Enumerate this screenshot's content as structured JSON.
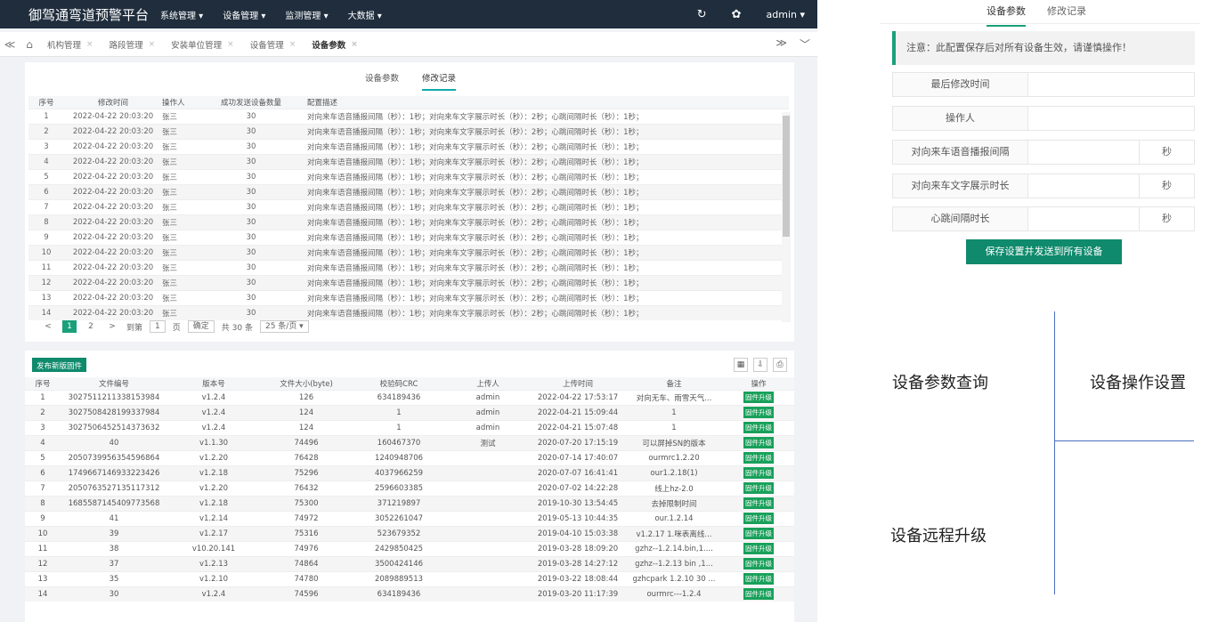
{
  "app": {
    "brand": "御驾通弯道预警平台",
    "menus": [
      "系统管理",
      "设备管理",
      "监测管理",
      "大数据"
    ],
    "user": "admin",
    "icons": {
      "refresh": "refresh-icon",
      "skin": "palette-icon",
      "home": "home-icon"
    }
  },
  "tabs": {
    "prev": "≪",
    "next": "≫",
    "down": "﹀",
    "items": [
      {
        "label": "机构管理",
        "close": "×"
      },
      {
        "label": "路段管理",
        "close": "×"
      },
      {
        "label": "安装单位管理",
        "close": "×"
      },
      {
        "label": "设备管理",
        "close": "×"
      },
      {
        "label": "设备参数",
        "close": "×"
      }
    ]
  },
  "subtabs": {
    "params": "设备参数",
    "history": "修改记录"
  },
  "history": {
    "headers": [
      "序号",
      "修改时间",
      "操作人",
      "成功发送设备数量",
      "配置描述"
    ],
    "time": "2022-04-22 20:03:20",
    "operator": "张三",
    "count": "30",
    "desc_a": "对向来车语音播报间隔（秒）：1秒；对向来车文字展示时长（秒）：2秒；心跳间隔时长（秒）：1秒；",
    "desc_b": "对向来车语音播报间隔（秒）：1秒；对向来车文字展示时长（秒）：2秒；心跳间隔时长（秒）：1秒；",
    "rows": [
      "1",
      "2",
      "3",
      "4",
      "5",
      "6",
      "7",
      "8",
      "9",
      "10",
      "11",
      "12",
      "13",
      "14"
    ]
  },
  "pager": {
    "prev": "<",
    "p1": "1",
    "p2": "2",
    "next": ">",
    "goto": "到第",
    "page_input": "1",
    "page_unit": "页",
    "confirm": "确定",
    "total": "共 30 条",
    "per_page": "25 条/页 ▾"
  },
  "firmware": {
    "publish_button": "发布新版固件",
    "headers": [
      "序号",
      "文件编号",
      "版本号",
      "文件大小(byte)",
      "校验码CRC",
      "上传人",
      "上传时间",
      "备注",
      "操作"
    ],
    "action_label": "固件升级",
    "rows": [
      [
        "1",
        "3027511211338153984",
        "v1.2.4",
        "126",
        "634189436",
        "admin",
        "2022-04-22 17:53:17",
        "对向无车、雨雪天气..."
      ],
      [
        "2",
        "3027508428199337984",
        "v1.2.4",
        "124",
        "1",
        "admin",
        "2022-04-21 15:09:44",
        "1"
      ],
      [
        "3",
        "3027506452514373632",
        "v1.2.4",
        "124",
        "1",
        "admin",
        "2022-04-21 15:07:48",
        "1"
      ],
      [
        "4",
        "40",
        "v1.1.30",
        "74496",
        "160467370",
        "测试",
        "2020-07-20 17:15:19",
        "可以屏掉SN的版本"
      ],
      [
        "5",
        "2050739956354596864",
        "v1.2.20",
        "76428",
        "1240948706",
        "",
        "2020-07-14 17:40:07",
        "ourmrc1.2.20"
      ],
      [
        "6",
        "1749667146933223426",
        "v1.2.18",
        "75296",
        "4037966259",
        "",
        "2020-07-07 16:41:41",
        "our1.2.18(1)"
      ],
      [
        "7",
        "2050763527135117312",
        "v1.2.20",
        "76432",
        "2596603385",
        "",
        "2020-07-02 14:22:28",
        "线上hz-2.0"
      ],
      [
        "8",
        "1685587145409773568",
        "v1.2.18",
        "75300",
        "371219897",
        "",
        "2019-10-30 13:54:45",
        "去掉限制时间"
      ],
      [
        "9",
        "41",
        "v1.2.14",
        "74972",
        "3052261047",
        "",
        "2019-05-13 10:44:35",
        "our.1.2.14"
      ],
      [
        "10",
        "39",
        "v1.2.17",
        "75316",
        "523679352",
        "",
        "2019-04-10 15:03:38",
        "v1.2.17 1.咪表离线..."
      ],
      [
        "11",
        "38",
        "v10.20.141",
        "74976",
        "2429850425",
        "",
        "2019-03-28 18:09:20",
        "gzhz--1.2.14.bin,1...."
      ],
      [
        "12",
        "37",
        "v1.2.13",
        "74864",
        "3500424146",
        "",
        "2019-03-28 14:27:12",
        "gzhz--1.2.13 bin ,1..."
      ],
      [
        "13",
        "35",
        "v1.2.10",
        "74780",
        "2089889513",
        "",
        "2019-03-22 18:08:44",
        "gzhcpark 1.2.10 30 ..."
      ],
      [
        "14",
        "30",
        "v1.2.4",
        "74596",
        "634189436",
        "",
        "2019-03-20 11:17:39",
        "ourmrc---1.2.4"
      ]
    ]
  },
  "settings": {
    "tab_params": "设备参数",
    "tab_history": "修改记录",
    "notice": "注意：此配置保存后对所有设备生效，请谨慎操作！",
    "fields": [
      {
        "label": "最后修改时间",
        "unit": ""
      },
      {
        "label": "操作人",
        "unit": ""
      },
      {
        "label": "对向来车语音播报间隔",
        "unit": "秒"
      },
      {
        "label": "对向来车文字展示时长",
        "unit": "秒"
      },
      {
        "label": "心跳间隔时长",
        "unit": "秒"
      }
    ],
    "save_button": "保存设置并发送到所有设备"
  },
  "annotations": {
    "query": "设备参数查询",
    "operate": "设备操作设置",
    "upgrade": "设备远程升级"
  }
}
